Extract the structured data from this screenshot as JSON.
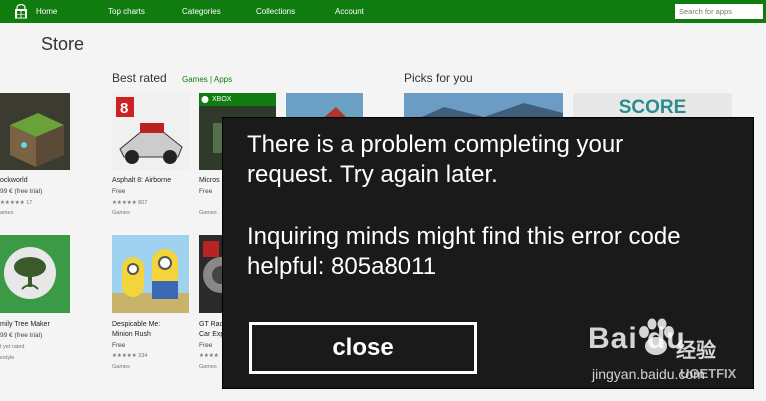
{
  "nav": {
    "items": [
      "Home",
      "Top charts",
      "Categories",
      "Collections",
      "Account"
    ],
    "search_placeholder": "Search for apps"
  },
  "store_title": "Store",
  "best_rated": {
    "heading": "Best rated",
    "links": "Games  |  Apps"
  },
  "picks": {
    "heading": "Picks for you"
  },
  "apps": [
    {
      "name": "ockworld",
      "price": "99 €   (free trial)",
      "rating": "17",
      "category": "ames"
    },
    {
      "name": "Asphalt 8: Airborne",
      "price": "Free",
      "rating": "★★★★★ 807",
      "category": "Games"
    },
    {
      "name": "Micros",
      "price": "Free",
      "rating": "",
      "category": "Games"
    },
    {
      "name": "mily Tree Maker",
      "price": "99 €   (free trial)",
      "rating": "t yet rated",
      "category": "estyle"
    },
    {
      "name": "Despicable Me:",
      "name2": "Minion Rush",
      "price": "Free",
      "rating": "★★★★★ 334",
      "category": "Games"
    },
    {
      "name": "GT Rac",
      "name2": "Car Exp",
      "price": "Free",
      "rating": "★★★★",
      "category": "Games"
    }
  ],
  "xbox_badge": "XBOX",
  "score_label": "SCORE",
  "dialog": {
    "message_line1": "There is a problem completing your",
    "message_line2": "request. Try again later.",
    "detail_line1": "Inquiring minds might find this error code",
    "detail_line2": "helpful: 805a8011",
    "close_label": "close"
  },
  "watermark": {
    "brand": "Bai  du",
    "brand_cn": "经验",
    "url": "jingyan.baidu.com",
    "secondary": "UGETFIX"
  },
  "colors": {
    "nav_bg": "#107c10",
    "dialog_bg": "#1a1a1a",
    "accent": "#107c10"
  }
}
